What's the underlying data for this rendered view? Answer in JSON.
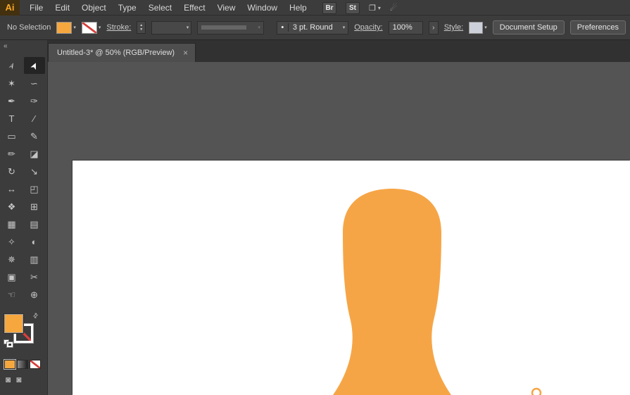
{
  "app": {
    "logo_text": "Ai",
    "menus": [
      "File",
      "Edit",
      "Object",
      "Type",
      "Select",
      "Effect",
      "View",
      "Window",
      "Help"
    ],
    "brushes_button_label": "Br",
    "graphic_styles_button_label": "St",
    "workspace_icon": "❐",
    "workspace_chevron": "▾",
    "touch_icon": "☄"
  },
  "control_bar": {
    "selection_status": "No Selection",
    "fill_chevron": "▾",
    "stroke_chevron": "▾",
    "stroke_label": "Stroke:",
    "stepper_up": "▲",
    "stepper_down": "▼",
    "weight_chevron": "▾",
    "profile_chevron": "▾",
    "brush_bullet": "•",
    "brush_value": "3 pt. Round",
    "brush_chevron": "▾",
    "opacity_label": "Opacity:",
    "opacity_value": "100%",
    "opacity_expand_arrow": "›",
    "style_label": "Style:",
    "style_chevron": "▾",
    "document_setup_label": "Document Setup",
    "preferences_label": "Preferences"
  },
  "tab": {
    "title": "Untitled-3* @ 50% (RGB/Preview)",
    "close_glyph": "×"
  },
  "toolbar": {
    "collapse_glyph": "«",
    "swap_glyph": "⇄",
    "tools": [
      {
        "name": "selection-tool",
        "glyph": "➢",
        "rot": -65
      },
      {
        "name": "direct-selection-tool",
        "glyph": "➤",
        "rot": -65,
        "active": true
      },
      {
        "name": "magic-wand-tool",
        "glyph": "✶"
      },
      {
        "name": "lasso-tool",
        "glyph": "∽"
      },
      {
        "name": "pen-tool",
        "glyph": "✒"
      },
      {
        "name": "curvature-tool",
        "glyph": "✑"
      },
      {
        "name": "type-tool",
        "glyph": "T"
      },
      {
        "name": "line-segment-tool",
        "glyph": "∕"
      },
      {
        "name": "rectangle-tool",
        "glyph": "▭"
      },
      {
        "name": "paintbrush-tool",
        "glyph": "✎"
      },
      {
        "name": "pencil-tool",
        "glyph": "✏"
      },
      {
        "name": "eraser-tool",
        "glyph": "◪"
      },
      {
        "name": "rotate-tool",
        "glyph": "↻"
      },
      {
        "name": "scale-tool",
        "glyph": "↘"
      },
      {
        "name": "width-tool",
        "glyph": "↔"
      },
      {
        "name": "free-transform-tool",
        "glyph": "◰"
      },
      {
        "name": "shape-builder-tool",
        "glyph": "❖"
      },
      {
        "name": "perspective-grid-tool",
        "glyph": "⊞"
      },
      {
        "name": "mesh-tool",
        "glyph": "▦"
      },
      {
        "name": "gradient-tool",
        "glyph": "▤"
      },
      {
        "name": "eyedropper-tool",
        "glyph": "✧"
      },
      {
        "name": "blend-tool",
        "glyph": "◐"
      },
      {
        "name": "symbol-sprayer-tool",
        "glyph": "✵"
      },
      {
        "name": "column-graph-tool",
        "glyph": "▥"
      },
      {
        "name": "artboard-tool",
        "glyph": "▣"
      },
      {
        "name": "slice-tool",
        "glyph": "✂"
      },
      {
        "name": "hand-tool",
        "glyph": "☜"
      },
      {
        "name": "zoom-tool",
        "glyph": "⊕"
      }
    ],
    "draw_mode_glyphs": [
      "◙",
      "◙"
    ]
  },
  "colors": {
    "fill_orange": "#F6A83F",
    "shape_orange": "#F6A546",
    "none_red": "#D8403C",
    "canvas_gray": "#545454"
  }
}
